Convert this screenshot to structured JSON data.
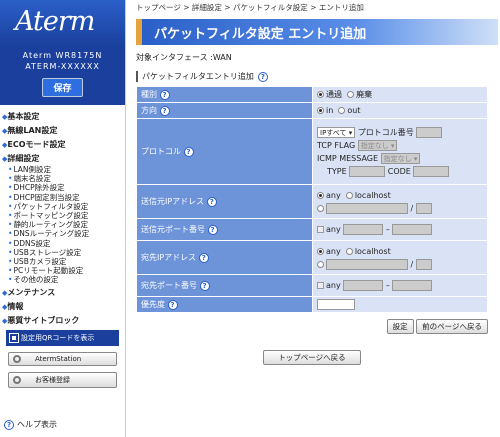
{
  "sidebar": {
    "logo": "Aterm",
    "model": "Aterm WR8175N",
    "serial": "ATERM-XXXXXX",
    "save_label": "保存",
    "nav": [
      {
        "label": "基本設定",
        "subs": []
      },
      {
        "label": "無線LAN設定",
        "subs": []
      },
      {
        "label": "ECOモード設定",
        "subs": []
      },
      {
        "label": "詳細設定",
        "subs": [
          "LAN側設定",
          "端末名設定",
          "DHCP除外設定",
          "DHCP固定割当設定",
          "パケットフィルタ設定",
          "ポートマッピング設定",
          "静的ルーティング設定",
          "DNSルーティング設定",
          "DDNS設定",
          "USBストレージ設定",
          "USBカメラ設定",
          "PCリモート起動設定",
          "その他の設定"
        ]
      },
      {
        "label": "メンテナンス",
        "subs": []
      },
      {
        "label": "情報",
        "subs": []
      },
      {
        "label": "悪質サイトブロック",
        "subs": []
      }
    ],
    "qr_label": "設定用QRコードを表示",
    "aterm_station": "AtermStation",
    "customer_reg": "お客様登録",
    "help_label": "ヘルプ表示"
  },
  "main": {
    "breadcrumb": "トップページ > 詳細設定 > パケットフィルタ設定 > エントリ追加",
    "title": "パケットフィルタ設定 エントリ追加",
    "interface": "対象インタフェース :WAN",
    "section_title": "パケットフィルタエントリ追加",
    "help_glyph": "?",
    "rows": {
      "type": {
        "label": "種別",
        "opt1": "通過",
        "opt2": "廃棄"
      },
      "direction": {
        "label": "方向",
        "opt1": "in",
        "opt2": "out"
      },
      "protocol": {
        "label": "プロトコル",
        "select": "IPすべて",
        "proto_num": "プロトコル番号",
        "tcp_flag": "TCP FLAG",
        "tcp_flag_val": "指定なし",
        "icmp": "ICMP MESSAGE",
        "icmp_val": "指定なし",
        "type": "TYPE",
        "code": "CODE"
      },
      "src_ip": {
        "label": "送信元IPアドレス",
        "any": "any",
        "local": "localhost",
        "slash": "/"
      },
      "src_port": {
        "label": "送信元ポート番号",
        "any": "any",
        "dash": "–"
      },
      "dst_ip": {
        "label": "宛先IPアドレス",
        "any": "any",
        "local": "localhost",
        "slash": "/"
      },
      "dst_port": {
        "label": "宛先ポート番号",
        "any": "any",
        "dash": "–"
      },
      "priority": {
        "label": "優先度"
      }
    },
    "set_btn": "設定",
    "prev_btn": "前のページへ戻る",
    "top_btn": "トップページへ戻る"
  }
}
